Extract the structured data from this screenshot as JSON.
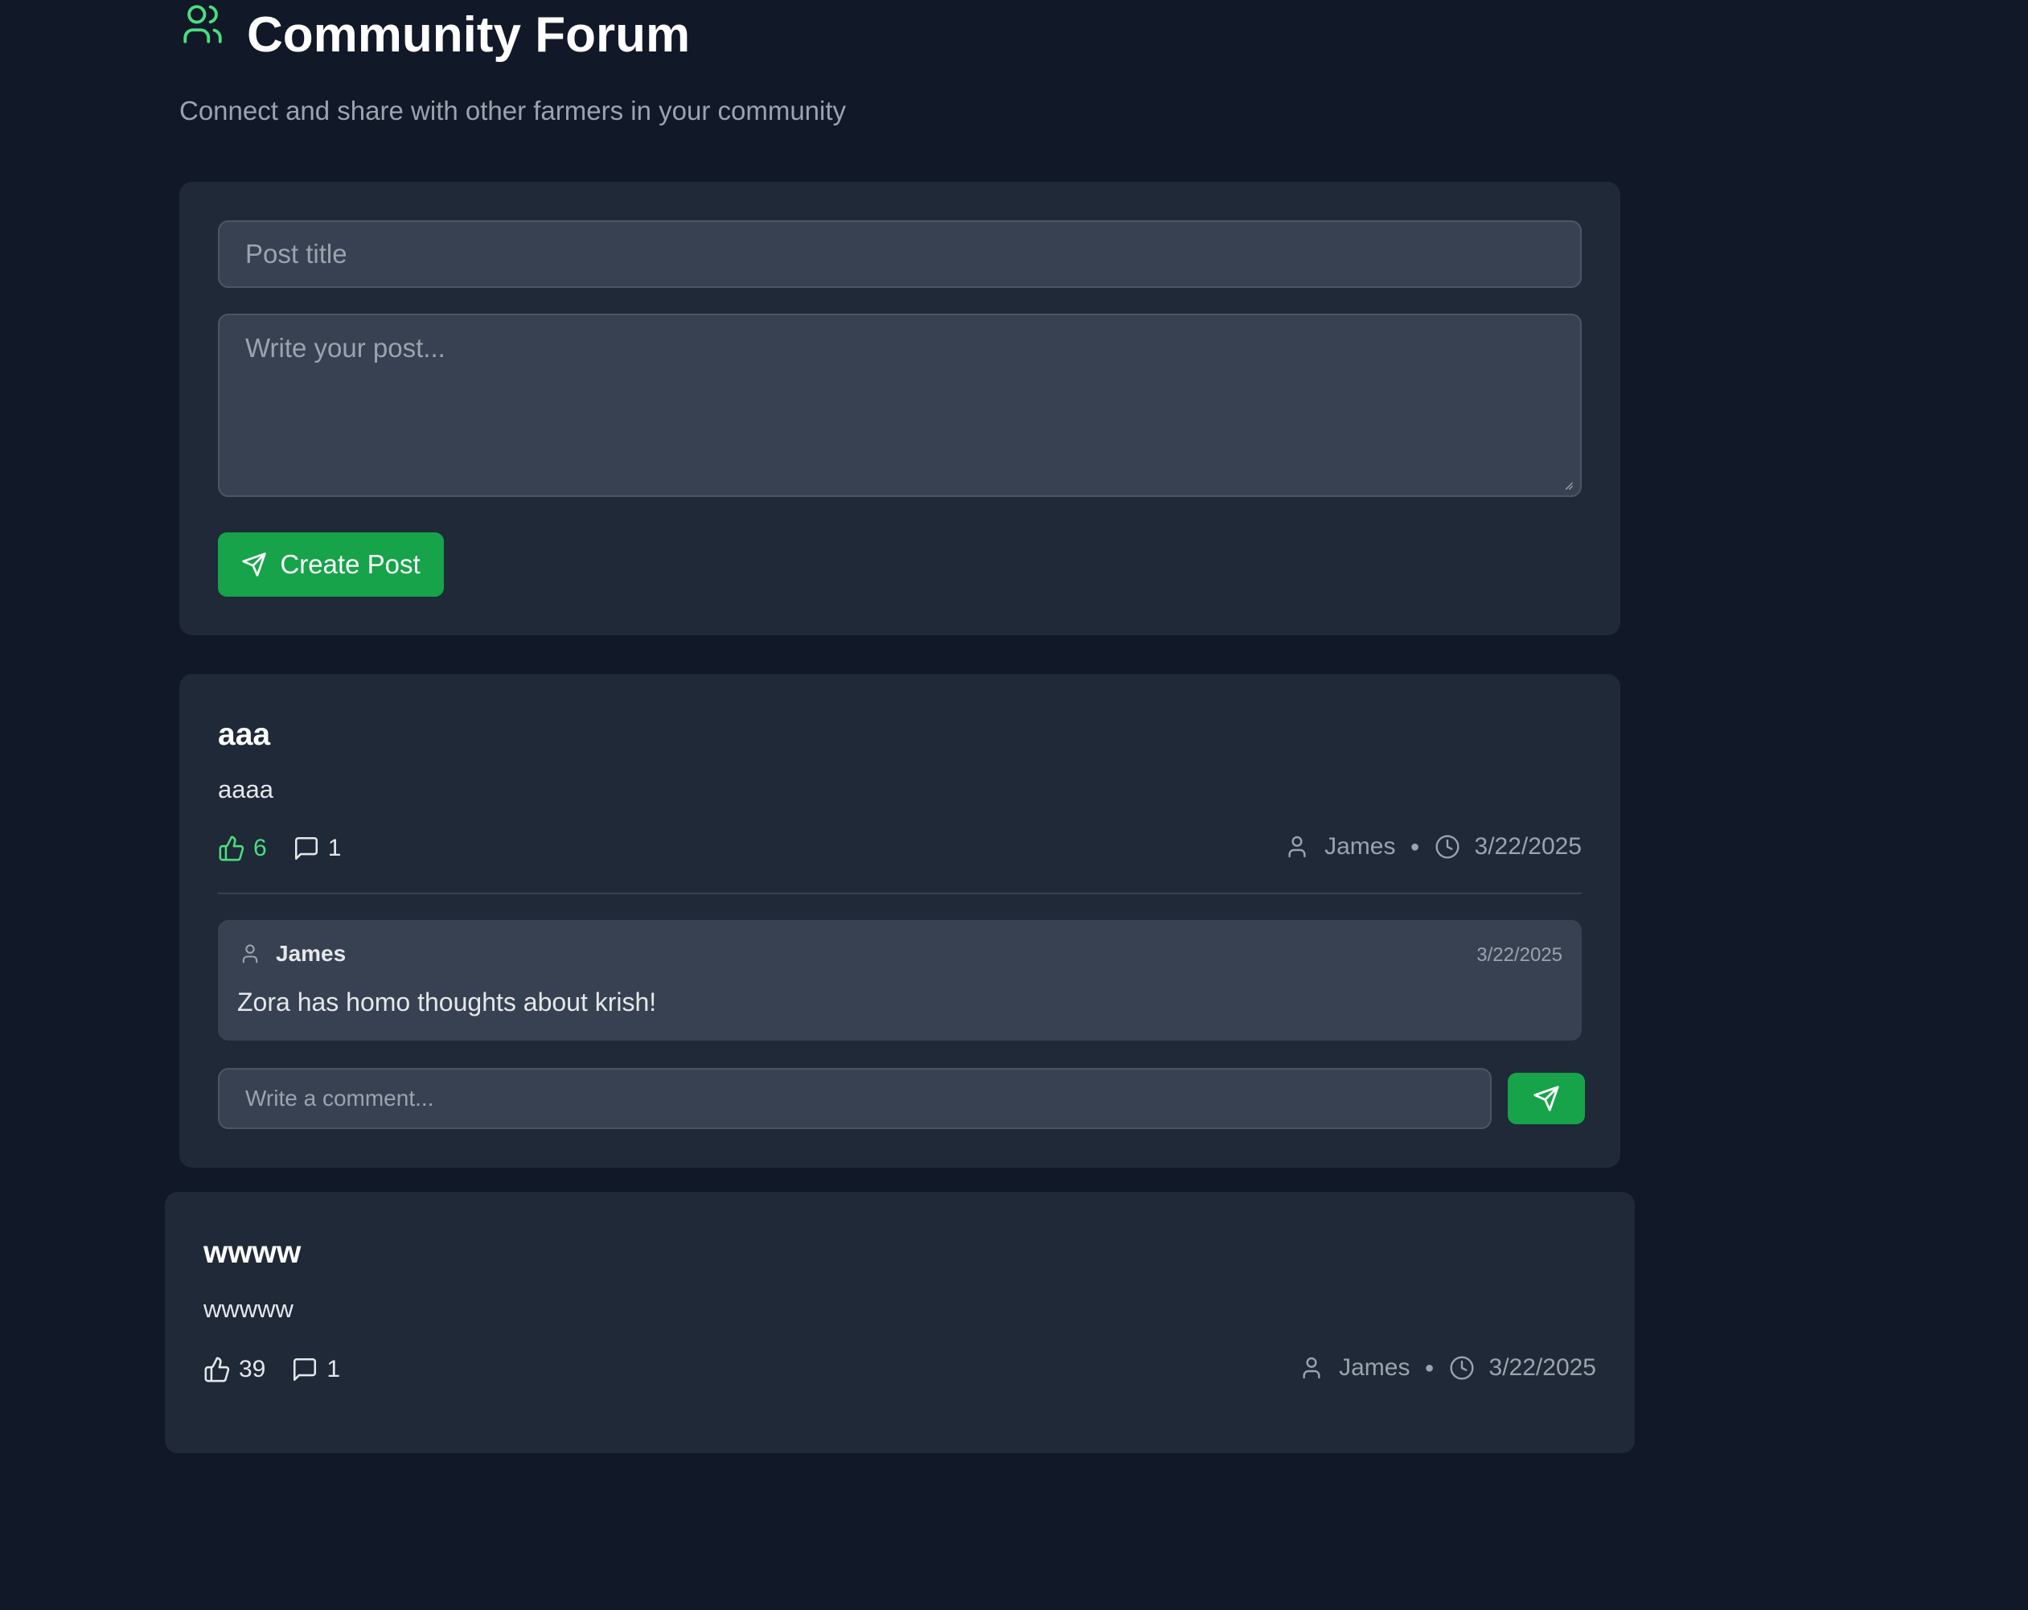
{
  "header": {
    "title": "Community Forum",
    "subtitle": "Connect and share with other farmers in your community",
    "icon": "users-icon"
  },
  "create_post": {
    "title_placeholder": "Post title",
    "body_placeholder": "Write your post...",
    "button_label": "Create Post"
  },
  "posts": [
    {
      "title": "aaa",
      "body": "aaaa",
      "likes": "6",
      "comments_count": "1",
      "liked": true,
      "author": "James",
      "date": "3/22/2025",
      "comments": [
        {
          "author": "James",
          "date": "3/22/2025",
          "text": "Zora has homo thoughts about krish!"
        }
      ],
      "comment_placeholder": "Write a comment..."
    },
    {
      "title": "wwww",
      "body": "wwwww",
      "likes": "39",
      "comments_count": "1",
      "liked": false,
      "author": "James",
      "date": "3/22/2025"
    }
  ],
  "colors": {
    "background": "#111827",
    "card": "#1f2937",
    "input": "#374151",
    "accent": "#16a34a",
    "liked": "#4ade80",
    "muted": "#9ca3af"
  }
}
